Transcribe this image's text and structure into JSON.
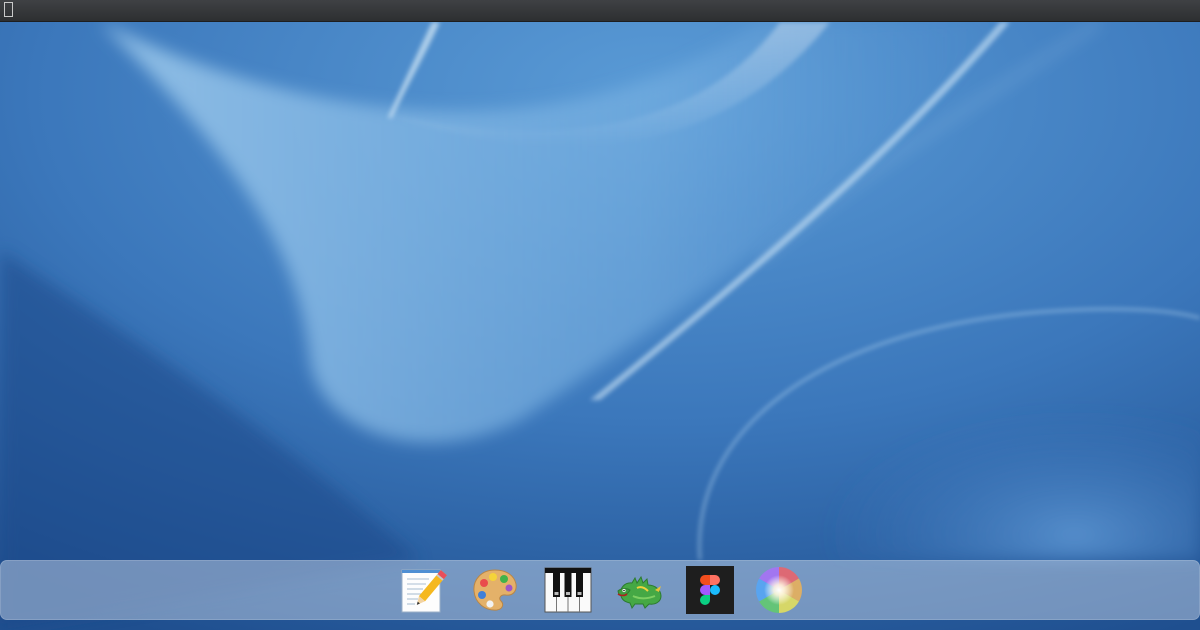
{
  "menubar": {
    "apple_menu_glyph": "",
    "background": "#36383b"
  },
  "wallpaper": {
    "base_color": "#3c79bd",
    "highlight_color": "#a9d2ee",
    "shadow_color": "#1d4a8a"
  },
  "dock": {
    "items": [
      {
        "name": "textedit-app",
        "icon": "notepad-pencil-icon"
      },
      {
        "name": "paint-app",
        "icon": "artist-palette-icon"
      },
      {
        "name": "piano-app",
        "icon": "piano-keyboard-icon"
      },
      {
        "name": "dragon-app",
        "icon": "green-dragon-icon"
      },
      {
        "name": "figma-app",
        "icon": "figma-logo-icon"
      },
      {
        "name": "spinner-app",
        "icon": "rainbow-swirl-icon"
      }
    ]
  }
}
